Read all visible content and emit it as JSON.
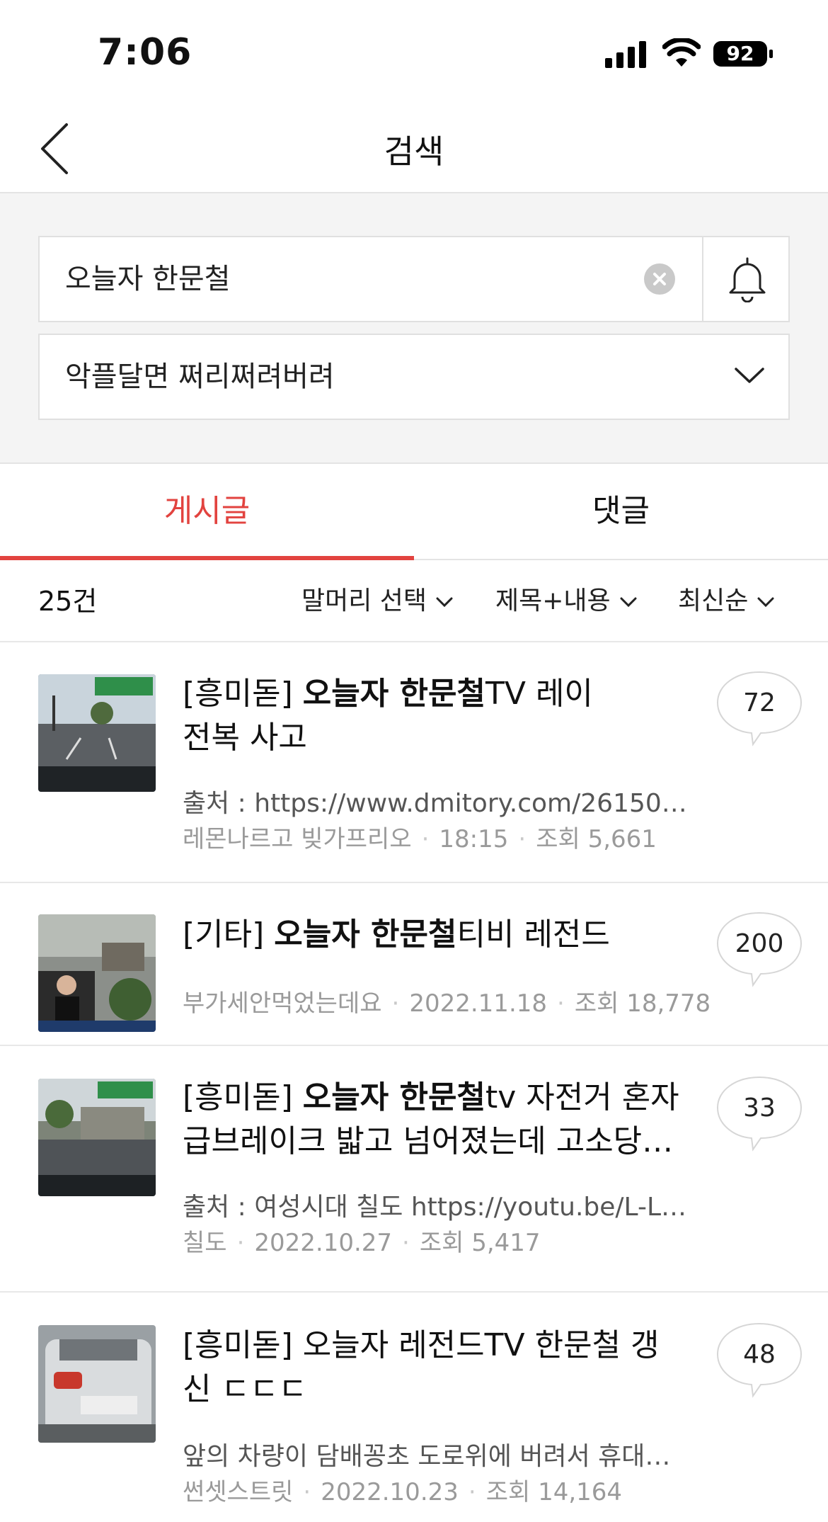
{
  "status": {
    "time": "7:06",
    "battery": "92"
  },
  "nav": {
    "title": "검색"
  },
  "search": {
    "query": "오늘자 한문철",
    "board_select": "악플달면 쩌리쩌려버려"
  },
  "tabs": [
    {
      "label": "게시글",
      "active": true
    },
    {
      "label": "댓글",
      "active": false
    }
  ],
  "filters": {
    "count": "25건",
    "prefix": "말머리 선택",
    "scope": "제목+내용",
    "sort": "최신순"
  },
  "colors": {
    "accent": "#e2433f"
  },
  "posts": [
    {
      "prefix": "[흥미돋]",
      "highlight": "오늘자 한문철",
      "title_rest": "TV 레이",
      "title_line2": "전복 사고",
      "snippet": "출처 : https://www.dmitory.com/261507...",
      "author": "레몬나르고 빚가프리오",
      "date": "18:15",
      "views": "조회 5,661",
      "comments": "72"
    },
    {
      "prefix": "[기타]",
      "highlight": "오늘자 한문철",
      "title_rest": "티비 레전드",
      "title_line2": "",
      "snippet": "",
      "author": "부가세안먹었는데요",
      "date": "2022.11.18",
      "views": "조회 18,778",
      "comments": "200"
    },
    {
      "prefix": "[흥미돋]",
      "highlight": "오늘자 한문철",
      "title_rest": "tv 자전거 혼자",
      "title_line2": "급브레이크 밟고 넘어졌는데 고소당…",
      "snippet": "출처 : 여성시대 칠도 https://youtu.be/L-Lj...",
      "author": "칠도",
      "date": "2022.10.27",
      "views": "조회 5,417",
      "comments": "33"
    },
    {
      "prefix": "[흥미돋]",
      "highlight": "",
      "title_rest": "오늘자 레전드TV 한문철 갱",
      "title_line2": "신 ㄷㄷㄷ",
      "snippet": "앞의 차량이 담배꽁초 도로위에 버려서 휴대…",
      "author": "썬셋스트릿",
      "date": "2022.10.23",
      "views": "조회 14,164",
      "comments": "48"
    }
  ]
}
